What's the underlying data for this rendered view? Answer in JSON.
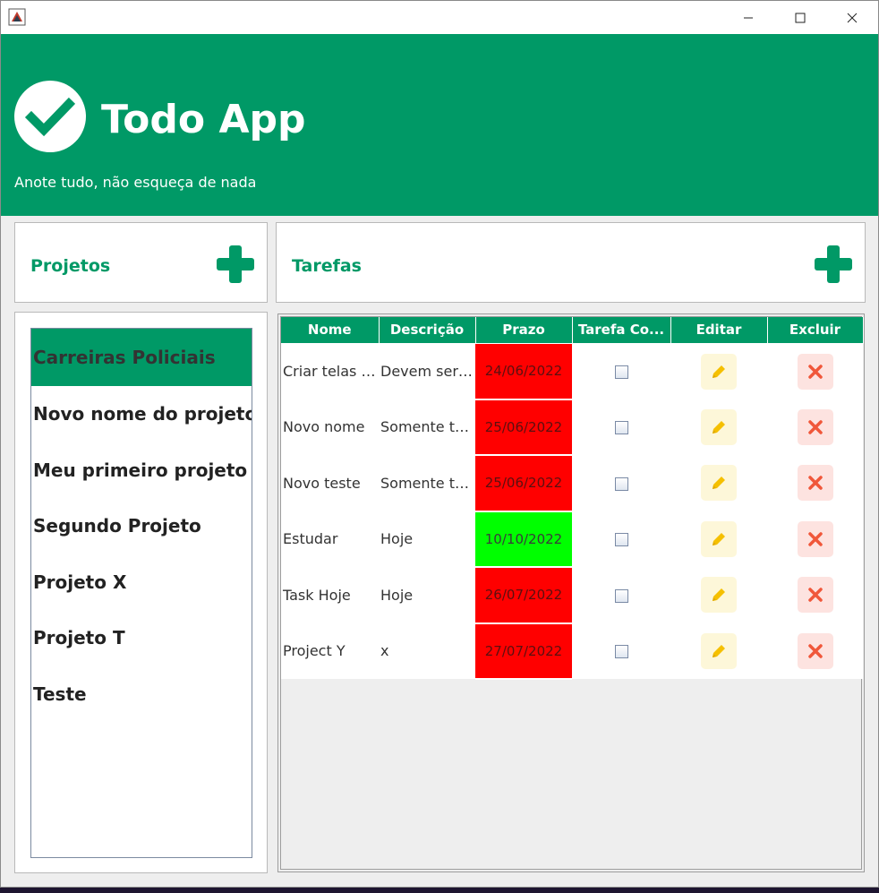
{
  "header": {
    "title": "Todo App",
    "subtitle": "Anote tudo, não esqueça de nada"
  },
  "projects": {
    "title": "Projetos",
    "selected_index": 0,
    "items": [
      {
        "label": "Carreiras Policiais"
      },
      {
        "label": "Novo nome do projeto"
      },
      {
        "label": "Meu primeiro projeto"
      },
      {
        "label": "Segundo Projeto"
      },
      {
        "label": "Projeto X"
      },
      {
        "label": "Projeto T"
      },
      {
        "label": "Teste"
      }
    ]
  },
  "tasks": {
    "title": "Tarefas",
    "columns": [
      "Nome",
      "Descrição",
      "Prazo",
      "Tarefa Co...",
      "Editar",
      "Excluir"
    ],
    "rows": [
      {
        "name": "Criar telas d...",
        "description": "Devem ser ...",
        "deadline": "24/06/2022",
        "status": "late",
        "completed": false
      },
      {
        "name": "Novo nome",
        "description": "Somente te...",
        "deadline": "25/06/2022",
        "status": "late",
        "completed": false
      },
      {
        "name": "Novo teste",
        "description": "Somente te...",
        "deadline": "25/06/2022",
        "status": "late",
        "completed": false
      },
      {
        "name": "Estudar",
        "description": "Hoje",
        "deadline": "10/10/2022",
        "status": "ok",
        "completed": false
      },
      {
        "name": "Task Hoje",
        "description": "Hoje",
        "deadline": "26/07/2022",
        "status": "late",
        "completed": false
      },
      {
        "name": "Project Y",
        "description": "x",
        "deadline": "27/07/2022",
        "status": "late",
        "completed": false
      }
    ]
  },
  "colors": {
    "brand": "#009966",
    "late": "#ff0000",
    "ok": "#00ff00",
    "edit_icon": "#f5c000",
    "delete_icon": "#f0573a"
  },
  "icons": {
    "logo": "check-circle-icon",
    "add": "plus-icon",
    "edit": "pencil-icon",
    "delete": "x-icon"
  }
}
